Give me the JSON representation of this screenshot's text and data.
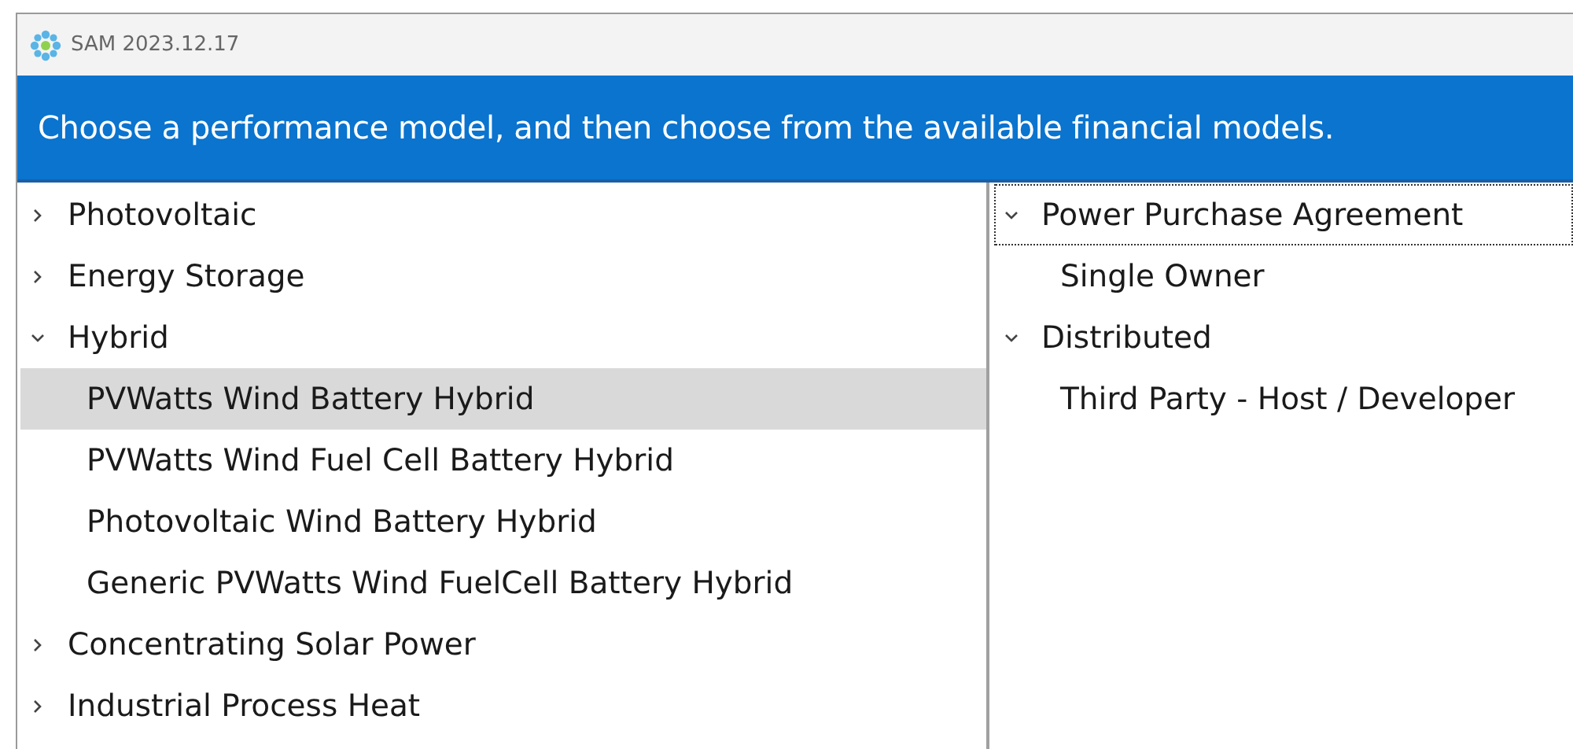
{
  "window": {
    "title": "SAM 2023.12.17"
  },
  "banner": {
    "text": "Choose a performance model, and then choose from the available financial models."
  },
  "performance_models": [
    {
      "label": "Photovoltaic",
      "expanded": false,
      "selected": false,
      "focused": false
    },
    {
      "label": "Energy Storage",
      "expanded": false,
      "selected": false,
      "focused": false
    },
    {
      "label": "Hybrid",
      "expanded": true,
      "selected": false,
      "focused": false,
      "children": [
        {
          "label": "PVWatts Wind Battery Hybrid",
          "selected": true,
          "focused": false
        },
        {
          "label": "PVWatts Wind Fuel Cell Battery Hybrid",
          "selected": false,
          "focused": false
        },
        {
          "label": "Photovoltaic Wind Battery Hybrid",
          "selected": false,
          "focused": false
        },
        {
          "label": "Generic PVWatts Wind FuelCell Battery Hybrid",
          "selected": false,
          "focused": false
        }
      ]
    },
    {
      "label": "Concentrating Solar Power",
      "expanded": false,
      "selected": false,
      "focused": false
    },
    {
      "label": "Industrial Process Heat",
      "expanded": false,
      "selected": false,
      "focused": false
    }
  ],
  "financial_models": [
    {
      "label": "Power Purchase Agreement",
      "expanded": true,
      "selected": false,
      "focused": true,
      "children": [
        {
          "label": "Single Owner",
          "selected": false,
          "focused": false
        }
      ]
    },
    {
      "label": "Distributed",
      "expanded": true,
      "selected": false,
      "focused": false,
      "children": [
        {
          "label": "Third Party - Host / Developer",
          "selected": false,
          "focused": false
        }
      ]
    }
  ]
}
